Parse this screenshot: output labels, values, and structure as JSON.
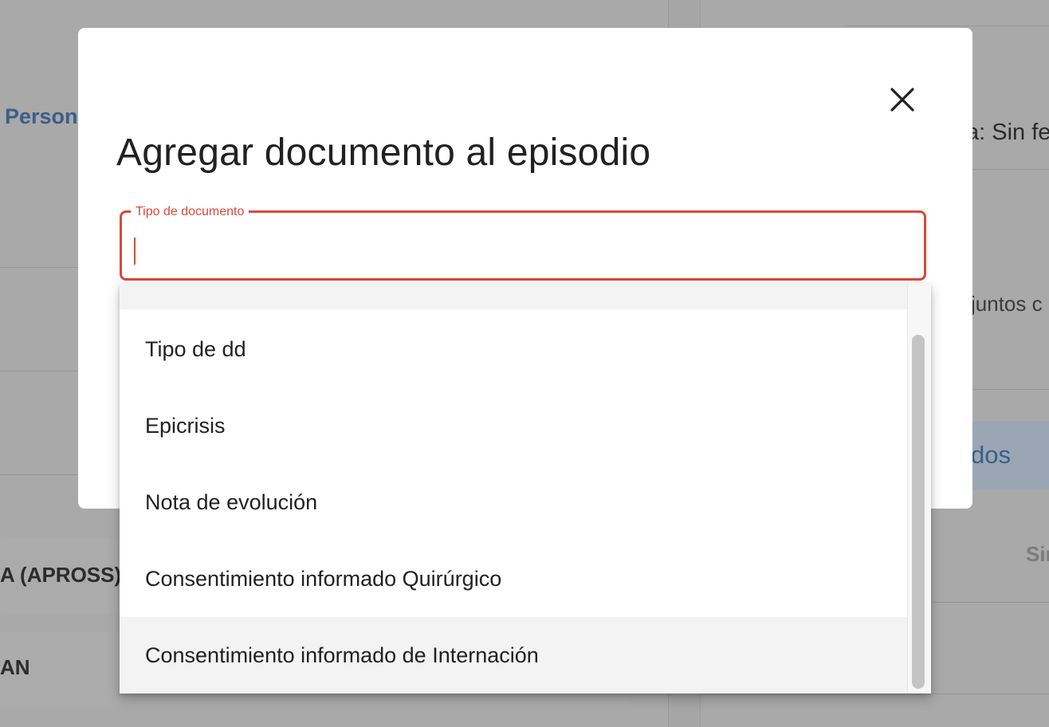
{
  "background": {
    "persona_text": "Person",
    "apross_text": "A (APROSS)",
    "an_text": "AN",
    "sin_fecha_text": "a: Sin fe",
    "adjuntos_text": "juntos c",
    "dos_text": "dos",
    "sin_text": "Sin"
  },
  "modal": {
    "title": "Agregar documento al episodio",
    "close_icon": "close-icon",
    "field": {
      "label": "Tipo de documento",
      "value": "",
      "placeholder": ""
    },
    "options": [
      {
        "label": "Tipo de dd"
      },
      {
        "label": "Epicrisis"
      },
      {
        "label": "Nota de evolución"
      },
      {
        "label": "Consentimiento informado Quirúrgico"
      },
      {
        "label": "Consentimiento informado de Internación"
      }
    ]
  },
  "colors": {
    "accent": "#d9493a",
    "overlay": "#a6a6a6",
    "link_blue": "#3a5f8a"
  }
}
